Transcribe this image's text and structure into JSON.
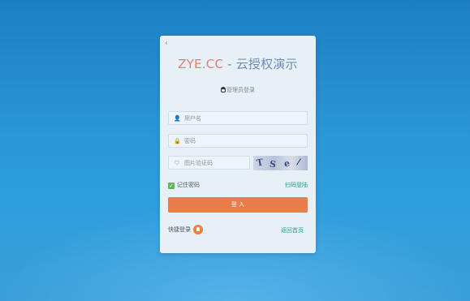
{
  "page": {
    "back_glyph": "‹",
    "title_brand": "ZYE.CC",
    "title_rest": " - 云授权演示",
    "subtitle": "管理员登录",
    "username_placeholder": "用户名",
    "password_placeholder": "密码",
    "captcha_placeholder": "图片验证码",
    "captcha_chars": [
      "T",
      "S",
      "e",
      "/"
    ],
    "remember_label": "记住密码",
    "remember_checked": true,
    "scan_login": "扫码登陆",
    "login_button": "登 入",
    "quick_login": "快捷登录",
    "back_home": "返回首页",
    "user_icon": "👤",
    "lock_icon": "🔒",
    "shield_icon": "⛉",
    "check_glyph": "✓"
  },
  "colors": {
    "accent_orange": "#ea7b4a",
    "link_green": "#22a38a",
    "checkbox_green": "#5cb85c",
    "title_blue": "#6c8cb8",
    "brand_red": "#e07f73"
  }
}
